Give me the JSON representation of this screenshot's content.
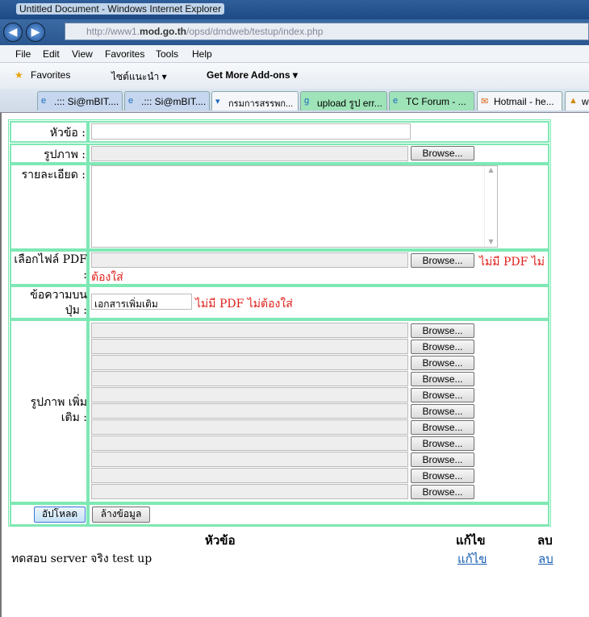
{
  "browser": {
    "title": "Untitled Document - Windows Internet Explorer",
    "url_prefix": "http://www1.",
    "url_domain": "mod.go.th",
    "url_path": "/opsd/dmdweb/testup/index.php",
    "menu": [
      "File",
      "Edit",
      "View",
      "Favorites",
      "Tools",
      "Help"
    ],
    "favorites_label": "Favorites",
    "suggested_sites": "ไซต์แนะนำ ▾",
    "addons": "Get More Add-ons ▾",
    "tabs": [
      ".::: Si@mBIT....",
      ".::: Si@mBIT....",
      "กรมการสรรพก...",
      "upload รูป err...",
      "TC Forum - ...",
      "Hotmail - he...",
      "w"
    ]
  },
  "form": {
    "title_label": "หัวข้อ :",
    "image_label": "รูปภาพ :",
    "detail_label": "รายละเอียด :",
    "pdf_label": "เลือกไฟล์ PDF :",
    "pdf_note1": "ไม่มี PDF ไม่",
    "pdf_note2": "ต้องใส่",
    "button_text_label": "ข้อความบน ปุ่ม :",
    "button_text_value": "เอกสารเพิ่มเติม",
    "button_text_note": "ไม่มี PDF ไม่ต้องใส่",
    "more_images_label": "รูปภาพ เพิ่ม เติม :",
    "browse": "Browse...",
    "upload": "อัปโหลด",
    "clear": "ล้างข้อมูล"
  },
  "list": {
    "headers": {
      "title": "หัวข้อ",
      "edit": "แก้ไข",
      "delete": "ลบ"
    },
    "rows": [
      {
        "title": "ทดสอบ server จริง test up",
        "edit": "แก้ไข",
        "delete": "ลบ"
      }
    ]
  }
}
